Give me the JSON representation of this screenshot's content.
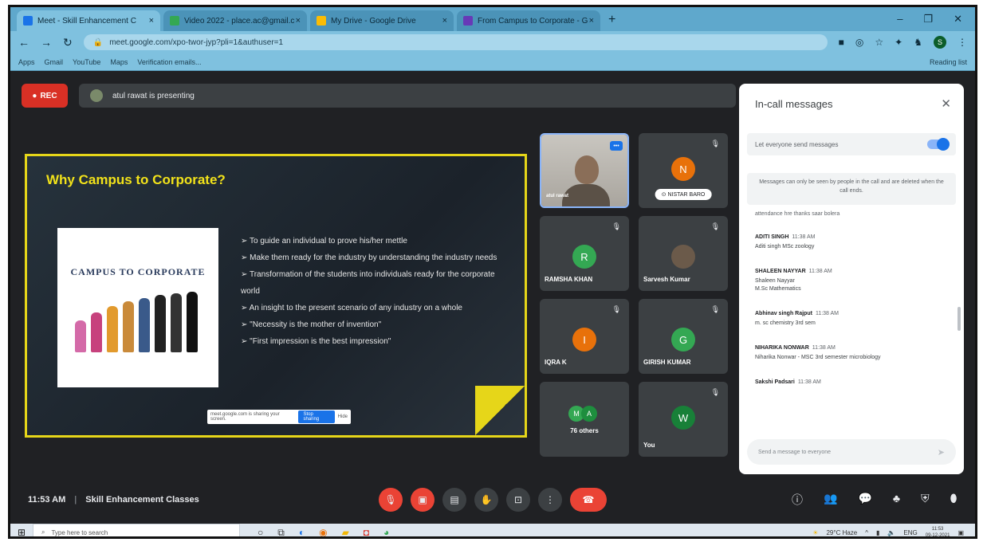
{
  "browser": {
    "tabs": [
      {
        "label": "Meet - Skill Enhancement C",
        "color": "#1a73e8"
      },
      {
        "label": "Video 2022 - place.ac@gmail.c",
        "color": "#34a853"
      },
      {
        "label": "My Drive - Google Drive",
        "color": "#fbbc04"
      },
      {
        "label": "From Campus to Corporate - G",
        "color": "#673ab7"
      }
    ],
    "new_tab": "+",
    "url": "meet.google.com/xpo-twor-jyp?pli=1&authuser=1",
    "bookmarks": [
      "Apps",
      "Gmail",
      "YouTube",
      "Maps",
      "Verification emails..."
    ],
    "reading_list": "Reading list",
    "profile_initial": "S"
  },
  "meet": {
    "rec_label": "REC",
    "presenting_text": "atul rawat is presenting",
    "slide": {
      "title": "Why Campus to Corporate?",
      "image_caption": "CAMPUS TO CORPORATE",
      "bullets": [
        "To guide an individual to prove his/her mettle",
        "Make them ready for the industry by understanding the industry needs",
        "Transformation of the students into individuals ready for the corporate world",
        "An insight to the present scenario of any industry on a whole",
        "\"Necessity is  the mother of invention\"",
        "\"First impression is the best impression\""
      ],
      "share_bar_text": "meet.google.com is sharing your screen.",
      "share_bar_stop": "Stop sharing",
      "share_bar_hide": "Hide"
    },
    "tiles": [
      {
        "name": "atul rawat",
        "type": "camera"
      },
      {
        "name": "NISTAR BARO",
        "initial": "N",
        "color": "#e8710a",
        "badge": true
      },
      {
        "name": "RAMSHA KHAN",
        "initial": "R",
        "color": "#34a853"
      },
      {
        "name": "Sarvesh Kumar",
        "type": "photo"
      },
      {
        "name": "IQRA K",
        "initial": "I",
        "color": "#e8710a"
      },
      {
        "name": "GIRISH KUMAR",
        "initial": "G",
        "color": "#34a853"
      },
      {
        "name": "76 others",
        "initials": [
          "M",
          "A"
        ],
        "colors": [
          "#34a853",
          "#1e8e3e"
        ]
      },
      {
        "name": "You",
        "initial": "W",
        "color": "#188038"
      }
    ],
    "time": "11:53 AM",
    "separator": "|",
    "meeting_name": "Skill Enhancement Classes"
  },
  "chat": {
    "title": "In-call messages",
    "toggle_label": "Let everyone send messages",
    "note": "Messages can only be seen by people in the call and are deleted when the call ends.",
    "clipped_text": "attendance hre thanks saar bolera",
    "messages": [
      {
        "sender": "ADITI SINGH",
        "time": "11:38 AM",
        "text": "Aditi singh MSc zoology"
      },
      {
        "sender": "SHALEEN NAYYAR",
        "time": "11:38 AM",
        "text": "Shaleen Nayyar\nM.Sc Mathematics"
      },
      {
        "sender": "Abhinav singh Rajput",
        "time": "11:38 AM",
        "text": "m. sc chemistry 3rd sem"
      },
      {
        "sender": "NIHARIKA NONWAR",
        "time": "11:38 AM",
        "text": "Niharika Nonwar - MSC 3rd semester microbiology"
      },
      {
        "sender": "Sakshi Padsari",
        "time": "11:38 AM",
        "text": ""
      }
    ],
    "input_placeholder": "Send a message to everyone"
  },
  "taskbar": {
    "search_placeholder": "Type here to search",
    "weather": "29°C Haze",
    "lang": "ENG",
    "clock_time": "11:53",
    "clock_date": "09-12-2021"
  }
}
